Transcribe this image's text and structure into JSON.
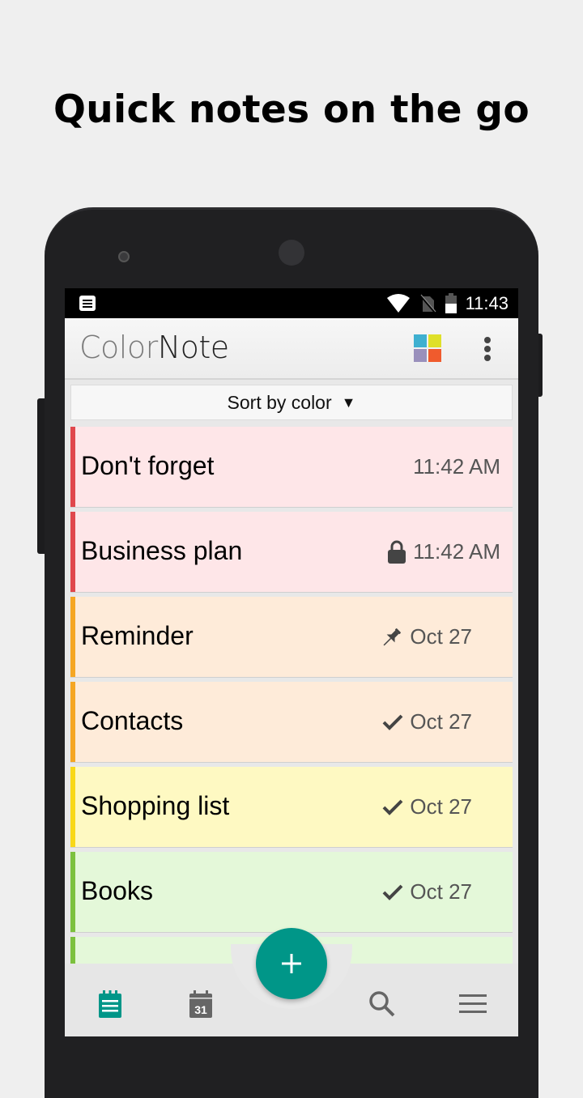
{
  "headline": "Quick notes on the go",
  "status_bar": {
    "time": "11:43",
    "icons": [
      "notification-icon",
      "wifi-icon",
      "no-sim-icon",
      "battery-icon"
    ]
  },
  "app_bar": {
    "logo_part1": "Color",
    "logo_part2": "Note",
    "color_filter_colors": [
      "#3fb0d0",
      "#dfe02a",
      "#9a90bc",
      "#f05b2d"
    ],
    "more_icon": "more-vert-icon"
  },
  "sort": {
    "label": "Sort by color",
    "arrow": "▼"
  },
  "notes": [
    {
      "title": "Don't forget",
      "meta": "11:42 AM",
      "icon": "",
      "bg": "#fee6e8",
      "accent": "#e0474c"
    },
    {
      "title": "Business plan",
      "meta": "11:42 AM",
      "icon": "lock-icon",
      "bg": "#fee6e8",
      "accent": "#e0474c"
    },
    {
      "title": "Reminder",
      "meta": "Oct 27",
      "icon": "pin-icon",
      "bg": "#feebd9",
      "accent": "#f5a623"
    },
    {
      "title": "Contacts",
      "meta": "Oct 27",
      "icon": "check-icon",
      "bg": "#feebd9",
      "accent": "#f5a623"
    },
    {
      "title": "Shopping list",
      "meta": "Oct 27",
      "icon": "check-icon",
      "bg": "#fef9c2",
      "accent": "#f8d818"
    },
    {
      "title": "Books",
      "meta": "Oct 27",
      "icon": "check-icon",
      "bg": "#e4f8d9",
      "accent": "#7cc13e"
    },
    {
      "title": "",
      "meta": "",
      "icon": "",
      "bg": "#e4f8d9",
      "accent": "#7cc13e"
    }
  ],
  "bottom_nav": {
    "items": [
      {
        "name": "notes-tab",
        "icon": "notes-icon",
        "active": true
      },
      {
        "name": "calendar-tab",
        "icon": "calendar-icon",
        "calendar_day": "31",
        "active": false
      },
      {
        "name": "search-tab",
        "icon": "search-icon",
        "active": false
      },
      {
        "name": "menu-tab",
        "icon": "menu-icon",
        "active": false
      }
    ],
    "fab_label": "+",
    "accent": "#009688"
  }
}
